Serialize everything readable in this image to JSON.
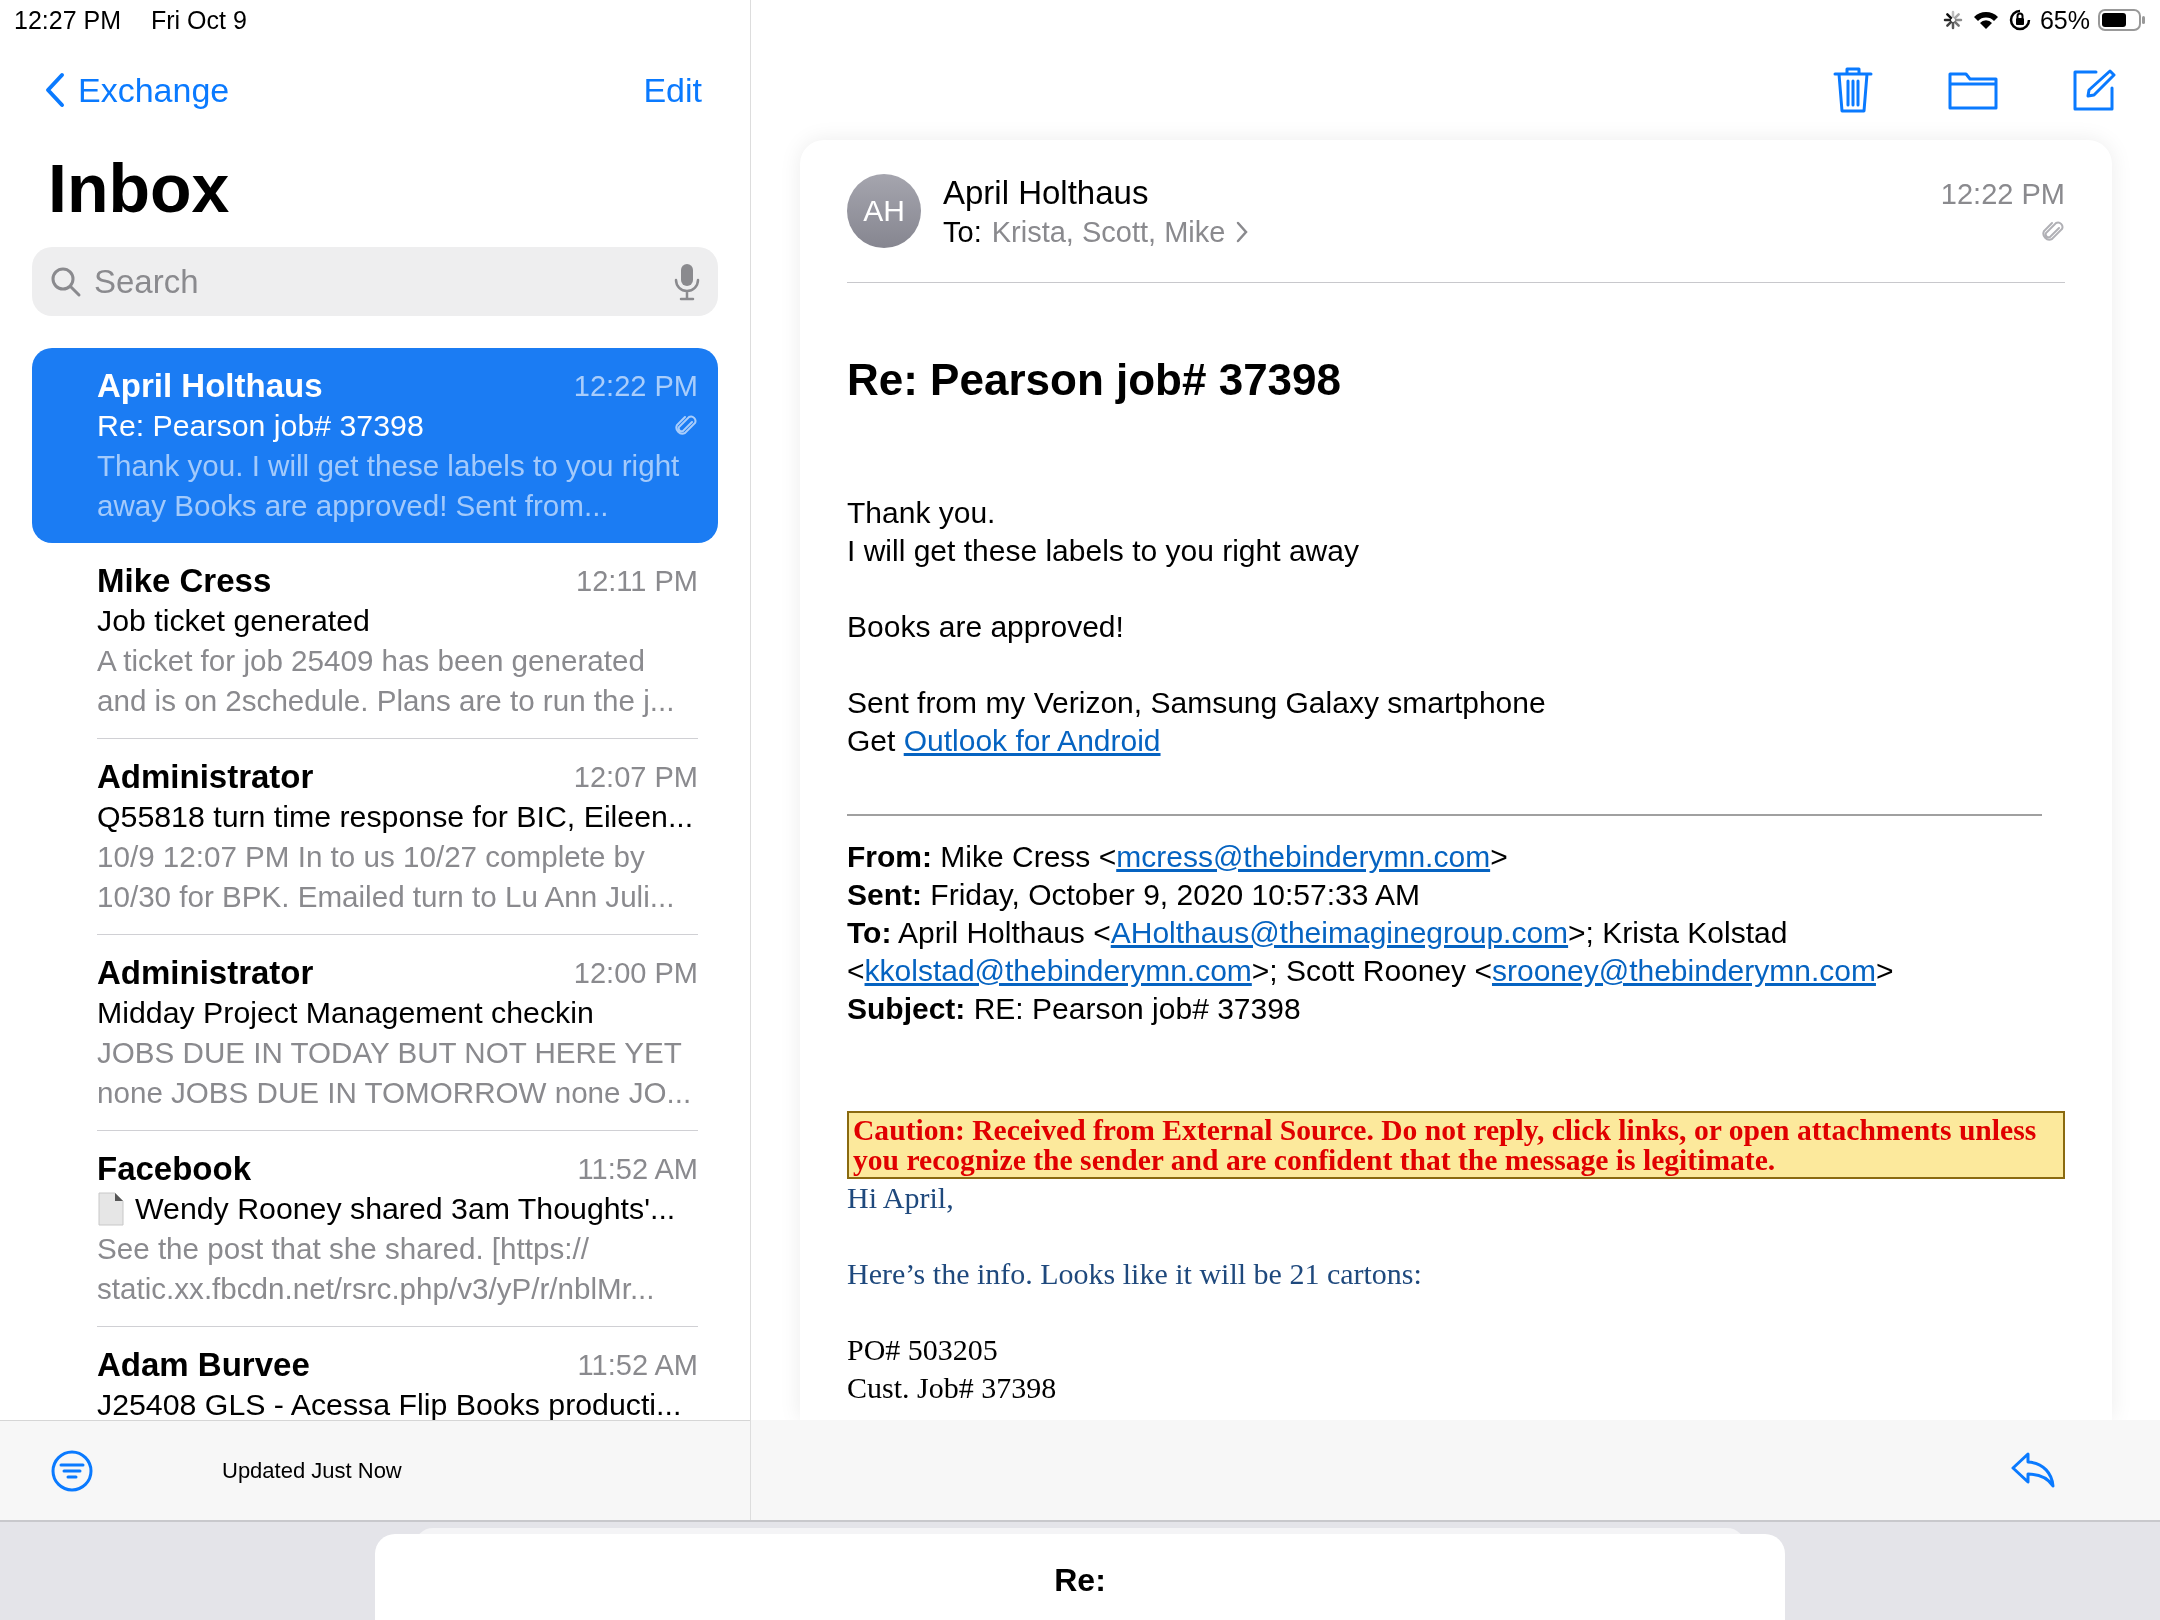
{
  "status_bar": {
    "time": "12:27 PM",
    "date": "Fri Oct 9",
    "battery": "65%"
  },
  "sidebar": {
    "back": "Exchange",
    "edit": "Edit",
    "title": "Inbox",
    "search": {
      "placeholder": "Search"
    },
    "messages": [
      {
        "sender": "April Holthaus",
        "time": "12:22 PM",
        "subject": "Re: Pearson job# 37398",
        "preview": "Thank you. I will get these labels to you right away Books are approved! Sent from...",
        "selected": true,
        "attachment": true,
        "document_icon": false
      },
      {
        "sender": "Mike Cress",
        "time": "12:11 PM",
        "subject": "Job ticket generated",
        "preview": "A ticket for job 25409 has been generated and is on 2schedule. Plans are to run the j...",
        "selected": false,
        "attachment": false,
        "document_icon": false
      },
      {
        "sender": "Administrator",
        "time": "12:07 PM",
        "subject": "Q55818 turn time response for BIC, Eileen...",
        "preview": "10/9 12:07 PM In to us 10/27 complete by 10/30 for BPK. Emailed turn to Lu Ann Juli...",
        "selected": false,
        "attachment": false,
        "document_icon": false
      },
      {
        "sender": "Administrator",
        "time": "12:00 PM",
        "subject": "Midday Project Management checkin",
        "preview": "JOBS DUE IN TODAY BUT NOT HERE YET none JOBS DUE IN TOMORROW none JO...",
        "selected": false,
        "attachment": false,
        "document_icon": false
      },
      {
        "sender": "Facebook",
        "time": "11:52 AM",
        "subject": "Wendy Rooney shared 3am Thoughts'...",
        "preview": "See the post that she shared. [https:// static.xx.fbcdn.net/rsrc.php/v3/yP/r/nblMr...",
        "selected": false,
        "attachment": false,
        "document_icon": true
      },
      {
        "sender": "Adam Burvee",
        "time": "11:52 AM",
        "subject": "J25408 GLS - Acessa Flip Books producti...",
        "selected": false,
        "attachment": false,
        "document_icon": false
      }
    ],
    "footer": "Updated Just Now"
  },
  "message": {
    "avatar": "AH",
    "sender": "April Holthaus",
    "to_label": "To:",
    "recipients": "Krista, Scott, Mike",
    "time": "12:22 PM",
    "attachment": true,
    "subject": "Re: Pearson job# 37398",
    "body": [
      [
        [
          {
            "text": "Thank you."
          }
        ],
        [
          {
            "text": "I will get these labels to you right away"
          }
        ]
      ],
      [
        [
          {
            "text": "Books are approved!"
          }
        ]
      ],
      [
        [
          {
            "text": "Sent from my Verizon, Samsung Galaxy smartphone"
          }
        ],
        [
          {
            "text": "Get "
          },
          {
            "link": "Outlook for Android"
          }
        ]
      ]
    ],
    "header_fields": [
      {
        "label": "From:",
        "segments": [
          {
            "text": " Mike Cress <"
          },
          {
            "link": "mcress@thebinderymn.com"
          },
          {
            "text": ">"
          }
        ]
      },
      {
        "label": "Sent:",
        "segments": [
          {
            "text": " Friday, October 9, 2020 10:57:33 AM"
          }
        ]
      },
      {
        "label": "To:",
        "segments": [
          {
            "text": " April Holthaus <"
          },
          {
            "link": "AHolthaus@theimaginegroup.com"
          },
          {
            "text": ">; Krista Kolstad <"
          },
          {
            "link": "kkolstad@thebinderymn.com"
          },
          {
            "text": ">; Scott Rooney <"
          },
          {
            "link": "srooney@thebinderymn.com"
          },
          {
            "text": ">"
          }
        ]
      },
      {
        "label": "Subject:",
        "segments": [
          {
            "text": " RE: Pearson job# 37398"
          }
        ]
      }
    ],
    "caution": "Caution: Received from External Source. Do not reply, click links, or open attachments unless you recognize the sender and are confident that the message is legitimate.",
    "reply": [
      [
        {
          "text": "Hi April,",
          "color": "#1f497d"
        }
      ],
      [
        {
          "text": "Here’s the info. Looks like it will be 21 cartons:",
          "color": "#1f497d"
        }
      ],
      [
        {
          "text": "PO# 503205",
          "color": "#000000"
        },
        {
          "text": "Cust. Job# 37398",
          "color": "#000000"
        }
      ]
    ]
  },
  "compose": {
    "title": "Re:"
  }
}
